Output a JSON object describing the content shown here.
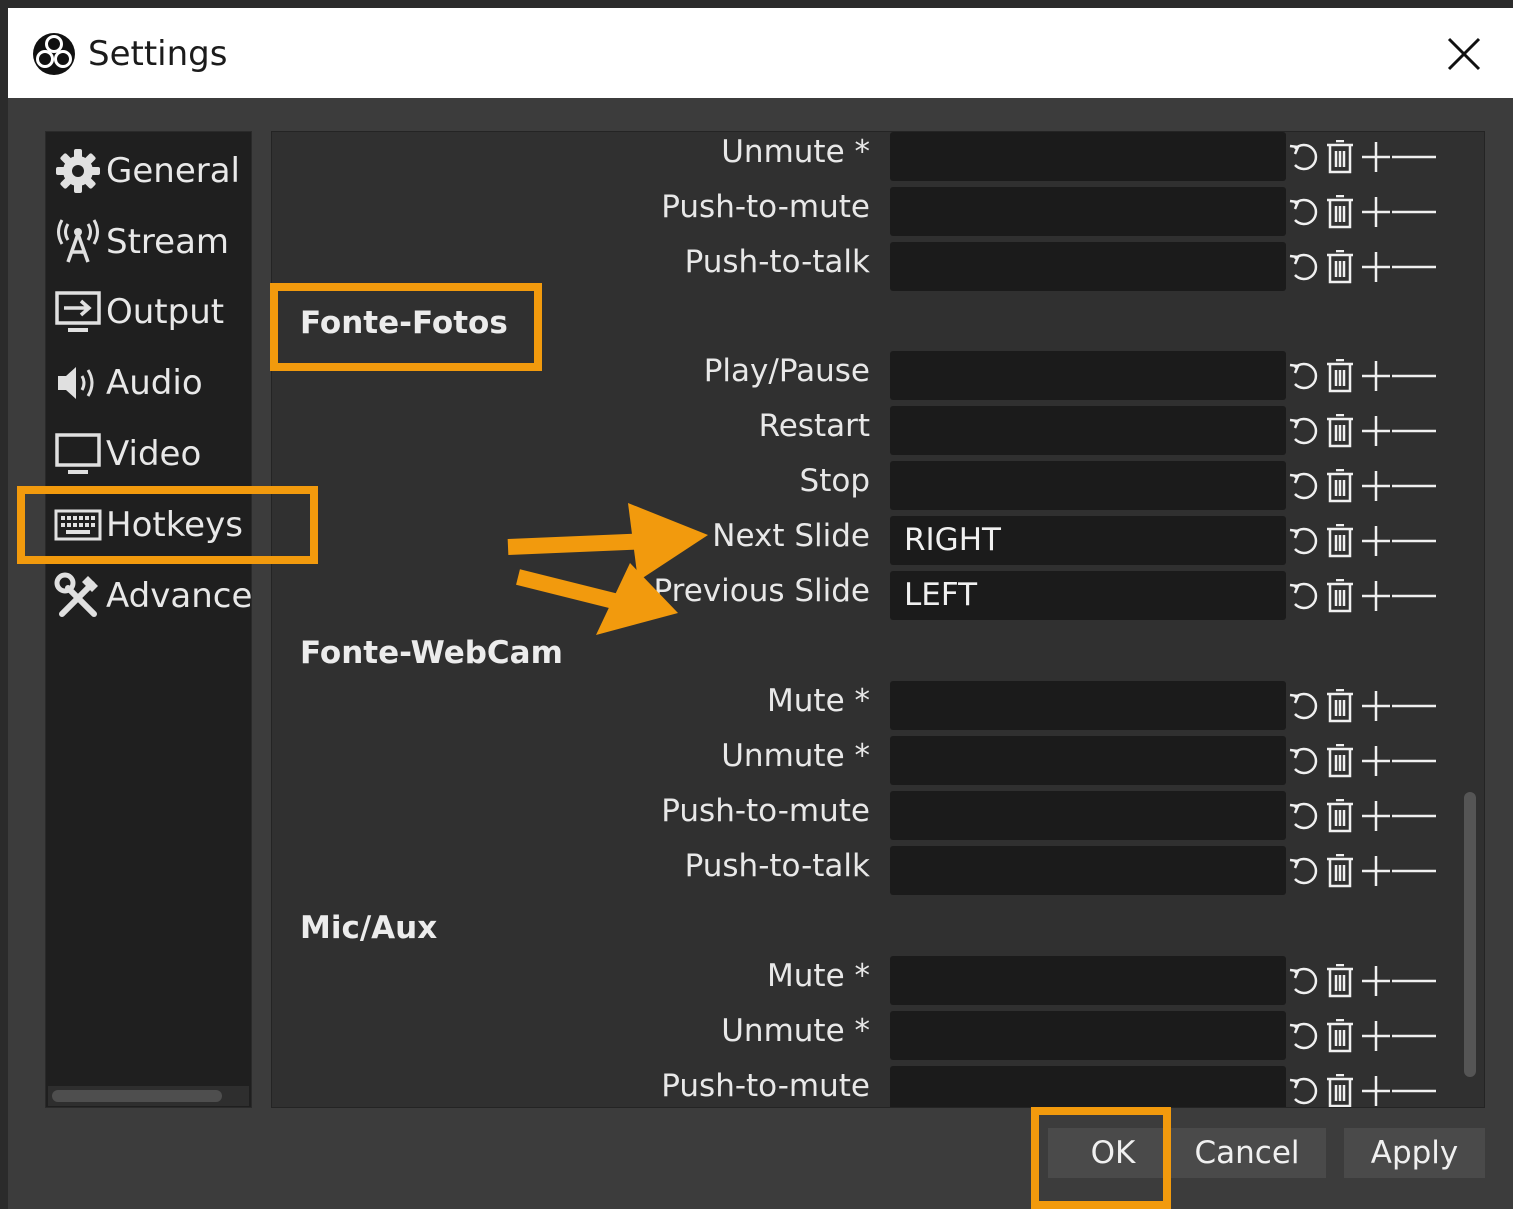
{
  "window": {
    "title": "Settings"
  },
  "sidebar": {
    "items": [
      {
        "label": "General",
        "icon": "gear-icon"
      },
      {
        "label": "Stream",
        "icon": "antenna-icon"
      },
      {
        "label": "Output",
        "icon": "monitor-output-icon"
      },
      {
        "label": "Audio",
        "icon": "speaker-icon"
      },
      {
        "label": "Video",
        "icon": "monitor-icon"
      },
      {
        "label": "Hotkeys",
        "icon": "keyboard-icon"
      },
      {
        "label": "Advance",
        "icon": "tools-icon"
      }
    ],
    "selected": "Hotkeys"
  },
  "hotkeys": {
    "rows": [
      {
        "label": "Unmute *",
        "value": ""
      },
      {
        "label": "Push-to-mute",
        "value": ""
      },
      {
        "label": "Push-to-talk",
        "value": ""
      }
    ],
    "groups": [
      {
        "title": "Fonte-Fotos",
        "rows": [
          {
            "label": "Play/Pause",
            "value": ""
          },
          {
            "label": "Restart",
            "value": ""
          },
          {
            "label": "Stop",
            "value": ""
          },
          {
            "label": "Next Slide",
            "value": "RIGHT"
          },
          {
            "label": "Previous Slide",
            "value": "LEFT"
          }
        ]
      },
      {
        "title": "Fonte-WebCam",
        "rows": [
          {
            "label": "Mute *",
            "value": ""
          },
          {
            "label": "Unmute *",
            "value": ""
          },
          {
            "label": "Push-to-mute",
            "value": ""
          },
          {
            "label": "Push-to-talk",
            "value": ""
          }
        ]
      },
      {
        "title": "Mic/Aux",
        "rows": [
          {
            "label": "Mute *",
            "value": ""
          },
          {
            "label": "Unmute *",
            "value": ""
          },
          {
            "label": "Push-to-mute",
            "value": ""
          }
        ]
      }
    ],
    "row_actions": [
      "revert-icon",
      "trash-icon",
      "plus-icon",
      "minus-icon"
    ]
  },
  "buttons": {
    "ok": "OK",
    "cancel": "Cancel",
    "apply": "Apply"
  },
  "colors": {
    "highlight": "#f29a0d",
    "field_bg": "#1b1b1b",
    "panel_bg": "#303030"
  }
}
